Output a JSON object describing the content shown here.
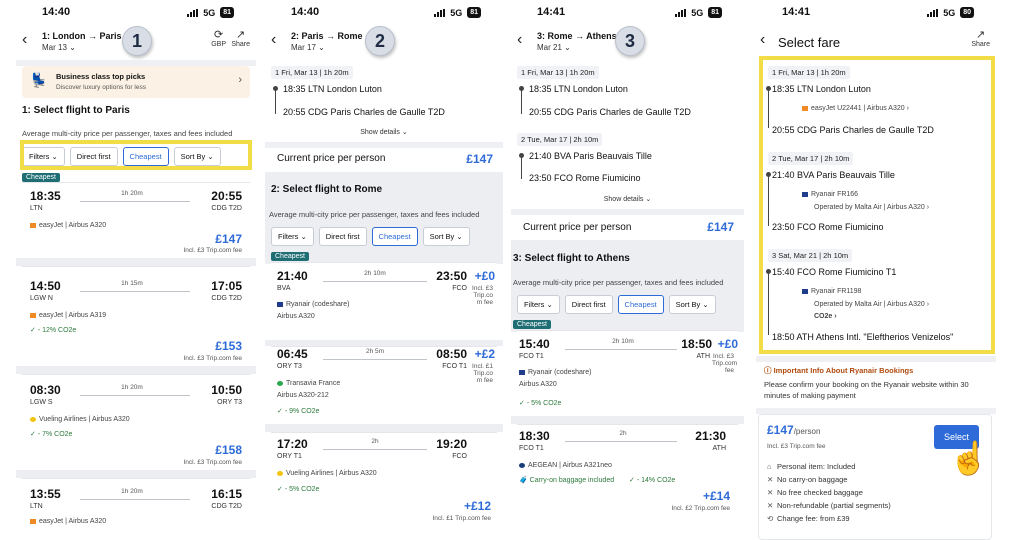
{
  "panel1": {
    "status": {
      "time": "14:40",
      "network": "5G",
      "battery": "81"
    },
    "header": {
      "route": "1: London → Paris",
      "date": "Mar 13",
      "step": "1",
      "currency_label": "GBP",
      "share_label": "Share"
    },
    "promo": {
      "title": "Business class top picks",
      "subtitle": "Discover luxury options for less"
    },
    "section_title": "1: Select flight to Paris",
    "subtitle": "Average multi-city price per passenger, taxes and fees included",
    "filters": [
      "Filters",
      "Direct first",
      "Cheapest",
      "Sort By"
    ],
    "tag": "Cheapest",
    "flights": [
      {
        "dep": "18:35",
        "dep_ap": "LTN",
        "dur": "1h 20m",
        "arr": "20:55",
        "arr_ap": "CDG T2D",
        "airline": "easyJet",
        "aircraft": "Airbus A320",
        "eco": "",
        "price": "£147",
        "fee": "Incl. £3 Trip.com fee"
      },
      {
        "dep": "14:50",
        "dep_ap": "LGW N",
        "dur": "1h 15m",
        "arr": "17:05",
        "arr_ap": "CDG T2D",
        "airline": "easyJet",
        "aircraft": "Airbus A319",
        "eco": "- 12% CO2e",
        "price": "£153",
        "fee": "Incl. £3 Trip.com fee"
      },
      {
        "dep": "08:30",
        "dep_ap": "LGW S",
        "dur": "1h 20m",
        "arr": "10:50",
        "arr_ap": "ORY T3",
        "airline": "Vueling Airlines",
        "aircraft": "Airbus A320",
        "eco": "- 7% CO2e",
        "price": "£158",
        "fee": "Incl. £3 Trip.com fee"
      },
      {
        "dep": "13:55",
        "dep_ap": "LTN",
        "dur": "1h 20m",
        "arr": "16:15",
        "arr_ap": "CDG T2D",
        "airline": "easyJet",
        "aircraft": "Airbus A320",
        "eco": "",
        "price": "",
        "fee": ""
      }
    ]
  },
  "panel2": {
    "status": {
      "time": "14:40",
      "network": "5G",
      "battery": "81"
    },
    "header": {
      "route": "2: Paris → Rome",
      "date": "Mar 17",
      "step": "2"
    },
    "seg1": {
      "head": "1  Fri, Mar 13  |  1h 20m",
      "dep": "18:35  LTN London Luton",
      "arr": "20:55  CDG Paris Charles de Gaulle T2D",
      "details": "Show details"
    },
    "current_price_label": "Current price per person",
    "current_price": "£147",
    "section_title": "2: Select flight to Rome",
    "subtitle": "Average multi-city price per passenger, taxes and fees included",
    "filters": [
      "Filters",
      "Direct first",
      "Cheapest",
      "Sort By"
    ],
    "tag": "Cheapest",
    "flights": [
      {
        "dep": "21:40",
        "dep_ap": "BVA",
        "dur": "2h 10m",
        "arr": "23:50",
        "arr_ap": "FCO",
        "airline": "Ryanair (codeshare)",
        "aircraft": "Airbus A320",
        "eco": "",
        "price": "+£0",
        "fee": "Incl. £3 Trip.co m fee"
      },
      {
        "dep": "06:45",
        "dep_ap": "ORY T3",
        "dur": "2h 5m",
        "arr": "08:50",
        "arr_ap": "FCO T1",
        "airline": "Transavia France",
        "aircraft": "Airbus A320-212",
        "eco": "- 9% CO2e",
        "price": "+£2",
        "fee": "Incl. £1 Trip.co m fee"
      },
      {
        "dep": "17:20",
        "dep_ap": "ORY T1",
        "dur": "2h",
        "arr": "19:20",
        "arr_ap": "FCO",
        "airline": "Vueling Airlines",
        "aircraft": "Airbus A320",
        "eco": "- 5% CO2e",
        "price": "+£12",
        "fee": "Incl. £1 Trip.com fee"
      }
    ]
  },
  "panel3": {
    "status": {
      "time": "14:41",
      "network": "5G",
      "battery": "81"
    },
    "header": {
      "route": "3: Rome → Athens",
      "date": "Mar 21",
      "step": "3"
    },
    "seg1": {
      "head": "1  Fri, Mar 13  |  1h 20m",
      "dep": "18:35  LTN London Luton",
      "arr": "20:55  CDG Paris Charles de Gaulle T2D"
    },
    "seg2": {
      "head": "2  Tue, Mar 17  |  2h 10m",
      "dep": "21:40  BVA Paris Beauvais Tille",
      "arr": "23:50  FCO Rome Fiumicino",
      "details": "Show details"
    },
    "current_price_label": "Current price per person",
    "current_price": "£147",
    "section_title": "3: Select flight to Athens",
    "subtitle": "Average multi-city price per passenger, taxes and fees included",
    "filters": [
      "Filters",
      "Direct first",
      "Cheapest",
      "Sort By"
    ],
    "tag": "Cheapest",
    "flights": [
      {
        "dep": "15:40",
        "dep_ap": "FCO T1",
        "dur": "2h 10m",
        "arr": "18:50",
        "arr_ap": "ATH",
        "airline": "Ryanair (codeshare)",
        "aircraft": "Airbus A320",
        "eco": "- 5% CO2e",
        "price": "+£0",
        "fee": "Incl. £3 Trip.com fee"
      },
      {
        "dep": "18:30",
        "dep_ap": "FCO T1",
        "dur": "2h",
        "arr": "21:30",
        "arr_ap": "ATH",
        "airline": "AEGEAN",
        "aircraft": "Airbus A321neo",
        "eco": "- 14% CO2e",
        "baggage": "Carry-on baggage included",
        "price": "+£14",
        "fee": "Incl. £2 Trip.com fee"
      }
    ]
  },
  "panel4": {
    "status": {
      "time": "14:41",
      "network": "5G",
      "battery": "80"
    },
    "title": "Select fare",
    "share_label": "Share",
    "segments": [
      {
        "head": "1  Fri, Mar 13  |  1h 20m",
        "dep": "18:35  LTN London Luton",
        "flight": "easyJet  U22441  |  Airbus A320",
        "operated": "",
        "arr": "20:55  CDG Paris Charles de Gaulle T2D"
      },
      {
        "head": "2  Tue, Mar 17  |  2h 10m",
        "dep": "21:40  BVA Paris Beauvais Tille",
        "flight": "Ryanair  FR166",
        "operated": "Operated by  Malta Air  |  Airbus A320",
        "arr": "23:50  FCO Rome Fiumicino"
      },
      {
        "head": "3  Sat, Mar 21  |  2h 10m",
        "dep": "15:40  FCO Rome Fiumicino T1",
        "flight": "Ryanair  FR1198",
        "operated": "Operated by  Malta Air  |  Airbus A320",
        "co2": "CO2e",
        "arr": "18:50  ATH Athens Intl. \"Eleftherios Venizelos\""
      }
    ],
    "important_title": "Important Info About Ryanair Bookings",
    "important_text": "Please confirm your booking on the Ryanair website within 30 minutes of making payment",
    "fare_price": "£147",
    "fare_unit": "/person",
    "fare_fee": "Incl. £3 Trip.com fee",
    "select_label": "Select",
    "inclusions": [
      {
        "icon": "bag",
        "text": "Personal item: Included"
      },
      {
        "icon": "x",
        "text": "No carry-on baggage"
      },
      {
        "icon": "x",
        "text": "No free checked baggage"
      },
      {
        "icon": "x",
        "text": "Non-refundable (partial segments)"
      },
      {
        "icon": "change",
        "text": "Change fee: from £39"
      }
    ]
  },
  "colors": {
    "accent": "#2e6bd8",
    "highlight": "#f2dd47",
    "tag": "#1f6e74",
    "eco": "#2c7a3c",
    "easyjet": "#f08a24"
  }
}
